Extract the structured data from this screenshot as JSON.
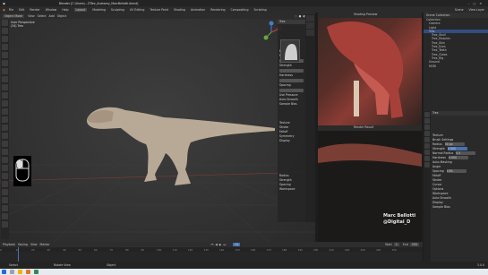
{
  "window": {
    "title": "Blender [C:\\Users\\...\\TRex_Anatomy_MarcBellotti.blend]"
  },
  "menu": {
    "items": [
      "File",
      "Edit",
      "Render",
      "Window",
      "Help"
    ],
    "workspaces": [
      "Layout",
      "Modeling",
      "Sculpting",
      "UV Editing",
      "Texture Paint",
      "Shading",
      "Animation",
      "Rendering",
      "Compositing",
      "Scripting"
    ],
    "active_workspace": "Layout",
    "scene": "Scene",
    "view_layer": "View Layer"
  },
  "viewport": {
    "mode": "Object Mode",
    "view_menu": [
      "View",
      "Select",
      "Add",
      "Object"
    ],
    "info_line1": "User Perspective",
    "info_line2": "(34) Trex"
  },
  "npanel": {
    "object_label": "Trex",
    "sections": [
      "Object",
      "Brush Settings",
      "Radius",
      "Strength",
      "Spacing",
      "Falloff",
      "Texture",
      "Stroke",
      "Symmetry",
      "Display",
      "Workspace"
    ],
    "fields": [
      "Radius",
      "Strength",
      "Hardness",
      "Spacing",
      "Use Pressure",
      "Auto Smooth",
      "Sample Bias"
    ]
  },
  "renders": {
    "header1": "Shading Preview",
    "header2": "Render Result",
    "watermark_line1": "Marc Bellotti",
    "watermark_line2": "@Digital_D"
  },
  "outliner": {
    "title": "Scene Collection",
    "rows": [
      "Scene Collection",
      "Collection",
      "Camera",
      "Light",
      "Trex",
      "Trex_Skull",
      "Trex_Muscles",
      "Trex_Skin",
      "Trex_Eyes",
      "Trex_Teeth",
      "Trex_Claws",
      "Trex_Rig",
      "Ground",
      "HDRI"
    ]
  },
  "properties": {
    "tab_title": "Trex",
    "rows": [
      "Texture",
      "Brush Settings",
      "Radius",
      "Strength",
      "Normal Radius",
      "Hardness",
      "Auto-Masking",
      "Angle",
      "Spacing",
      "Falloff",
      "Stroke",
      "Cursor",
      "Options",
      "Workspace",
      "Auto Smooth",
      "Display",
      "Sample Bias"
    ],
    "values": [
      "50 px",
      "0.500",
      "0.5",
      "0.000",
      "10%"
    ]
  },
  "timeline": {
    "menus": [
      "Playback",
      "Keying",
      "View",
      "Marker"
    ],
    "frame_current": "34",
    "start_label": "Start",
    "start": "1",
    "end_label": "End",
    "end": "250",
    "ticks": [
      "0",
      "10",
      "20",
      "30",
      "40",
      "50",
      "60",
      "70",
      "80",
      "90",
      "100",
      "110",
      "120",
      "130",
      "140",
      "150",
      "160",
      "170",
      "180",
      "190",
      "200",
      "210",
      "220",
      "230",
      "240",
      "250"
    ]
  },
  "status": {
    "left": "Select",
    "middle": "Rotate View",
    "right": "Object",
    "version": "3.0.0"
  },
  "colors": {
    "accent": "#4772b3",
    "bg": "#1d1d1d"
  }
}
